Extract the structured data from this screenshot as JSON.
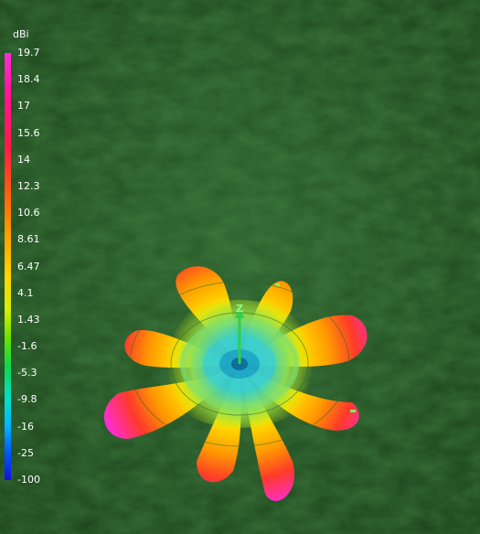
{
  "legend": {
    "unit": "dBi",
    "ticks": [
      "19.7",
      "18.4",
      "17",
      "15.6",
      "14",
      "12.3",
      "10.6",
      "8.61",
      "6.47",
      "4.1",
      "1.43",
      "-1.6",
      "-5.3",
      "-9.8",
      "-16",
      "-25",
      "-100"
    ]
  },
  "scene": {
    "axis_label": "Z",
    "background_color": "#1f4a1f",
    "pattern_colors": {
      "max": "#ff2bd8",
      "high": "#ff3a2a",
      "mid": "#ffd400",
      "low": "#5ee05e",
      "min": "#20c8e8"
    }
  }
}
